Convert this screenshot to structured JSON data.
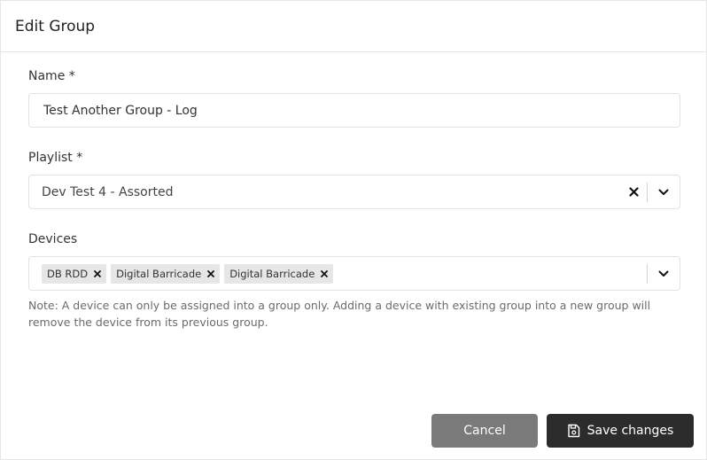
{
  "dialog": {
    "title": "Edit Group"
  },
  "form": {
    "name": {
      "label": "Name *",
      "value": "Test Another Group - Log"
    },
    "playlist": {
      "label": "Playlist *",
      "selected": "Dev Test 4 - Assorted"
    },
    "devices": {
      "label": "Devices",
      "selected": [
        "DB RDD",
        "Digital Barricade",
        "Digital Barricade"
      ],
      "note": "Note: A device can only be assigned into a group only. Adding a device with existing group into a new group will remove the device from its previous group."
    }
  },
  "actions": {
    "cancel_label": "Cancel",
    "save_label": "Save changes"
  },
  "icons": {
    "clear": "close-icon",
    "dropdown": "chevron-down-icon",
    "tag_remove": "close-icon",
    "save": "save-icon"
  }
}
